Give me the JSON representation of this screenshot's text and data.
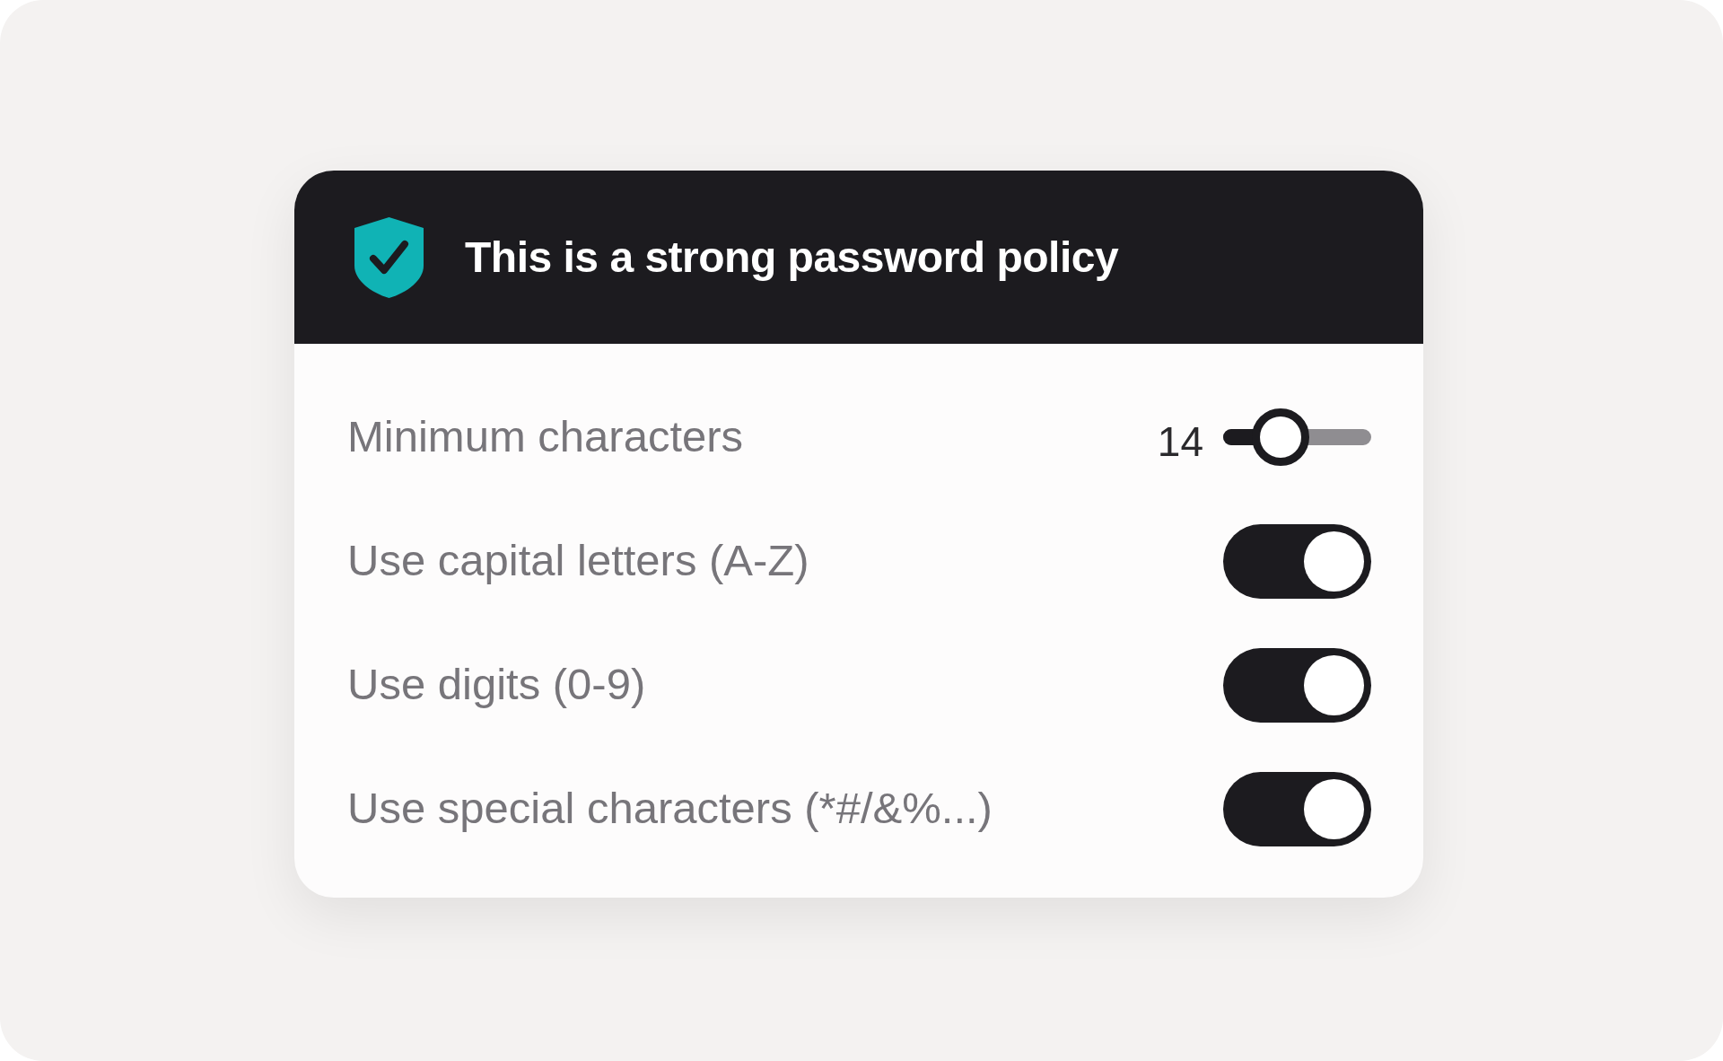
{
  "header": {
    "title": "This is a strong password policy"
  },
  "slider": {
    "label": "Minimum characters",
    "value": "14",
    "level": 0.39
  },
  "toggles": [
    {
      "label": "Use capital letters (A-Z)",
      "on": true
    },
    {
      "label": "Use digits (0-9)",
      "on": true
    },
    {
      "label": "Use special characters (*#/&%...)",
      "on": true
    }
  ]
}
